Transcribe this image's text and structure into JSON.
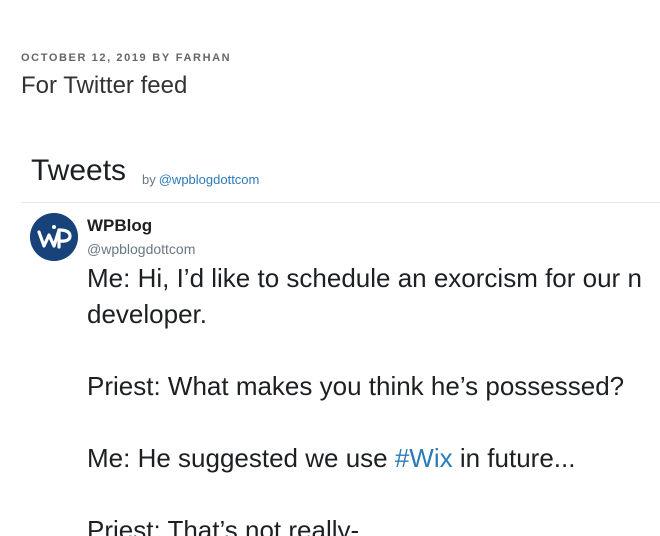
{
  "post": {
    "date": "OCTOBER 12, 2019",
    "by_label": "BY",
    "author": "FARHAN",
    "title": "For Twitter feed"
  },
  "timeline": {
    "title": "Tweets",
    "by_label": "by",
    "handle": "@wpblogdottcom"
  },
  "tweet": {
    "avatar_icon": "wpblog-logo-icon",
    "avatar_text": "WP",
    "author_name": "WPBlog",
    "author_handle": "@wpblogdottcom",
    "line1": "Me: Hi, I’d like to schedule an exorcism for our n",
    "line2": "developer.",
    "line3": "Priest: What makes you think he’s possessed?",
    "line4_before": "Me: He suggested we use ",
    "line4_hashtag": "#Wix",
    "line4_after": " in future...",
    "line5": "Priest: That’s not really-"
  },
  "colors": {
    "link": "#2b7bb9",
    "text": "#1c2022",
    "muted": "#697882",
    "avatar_bg": "#17437a"
  }
}
